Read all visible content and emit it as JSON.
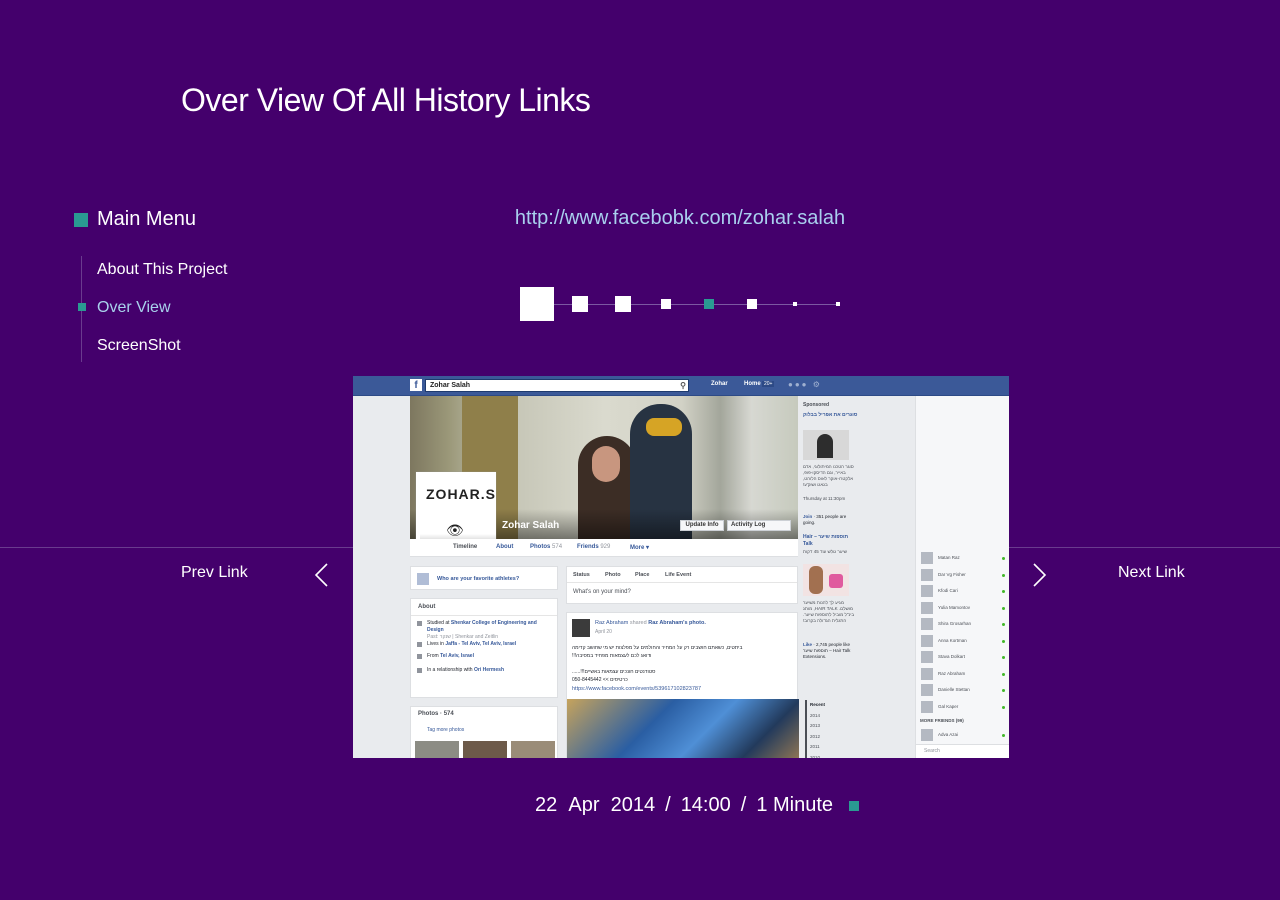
{
  "header": {
    "title_light": "Over View Of All ",
    "title_bold": "History Links"
  },
  "menu": {
    "heading": "Main Menu",
    "items": [
      {
        "label": "About This Project",
        "active": false
      },
      {
        "label": "Over View",
        "active": true
      },
      {
        "label": "ScreenShot",
        "active": false
      }
    ]
  },
  "link": {
    "url": "http://www.facebobk.com/zohar.salah"
  },
  "pager": {
    "current_index": 0,
    "accent_index": 4,
    "count": 8
  },
  "nav": {
    "prev_label": "Prev Link",
    "next_label": "Next Link"
  },
  "footer": {
    "day": "22",
    "month": "Apr",
    "year": "2014",
    "time": "14:00",
    "duration": "1 Minute"
  },
  "colors": {
    "background": "#44006c",
    "accent": "#2a9a92",
    "link": "#a9cfee",
    "facebook_blue": "#3b5998"
  },
  "screenshot": {
    "search_value": "Zohar Salah",
    "user": "Zohar",
    "home": "Home",
    "home_badge": "20+",
    "profile_name": "Zohar Salah",
    "avatar_text": "ZOHAR.S",
    "update_info": "Update Info",
    "activity_log": "Activity Log",
    "tabs": [
      {
        "label": "Timeline",
        "count": ""
      },
      {
        "label": "About",
        "count": ""
      },
      {
        "label": "Photos",
        "count": "574"
      },
      {
        "label": "Friends",
        "count": "929"
      },
      {
        "label": "More ▾",
        "count": ""
      }
    ],
    "athletes_prompt": "Who are your favorite athletes?",
    "about": {
      "heading": "About",
      "rows": [
        {
          "prefix": "Studied at ",
          "bold": "Shenkar College of Engineering and Design",
          "sub": "Past: שנקר | Shenkar and Zeitlin"
        },
        {
          "prefix": "Lives in ",
          "bold": "Jaffa - Tel Aviv, Tel Aviv, Israel",
          "sub": ""
        },
        {
          "prefix": "From ",
          "bold": "Tel Aviv, Israel",
          "sub": ""
        },
        {
          "prefix": "In a relationship with ",
          "bold": "Ori Hermesh",
          "sub": ""
        }
      ]
    },
    "photos": {
      "heading": "Photos",
      "count": "574",
      "tag": "Tag more photos"
    },
    "composer": {
      "actions": [
        "Status",
        "Photo",
        "Place",
        "Life Event"
      ],
      "placeholder": "What's on your mind?"
    },
    "post": {
      "author": "Raz Abraham",
      "shared": "shared",
      "shared_from": "Raz Abraham's photo.",
      "date": "April 20",
      "lines": [
        "ביתטים, כשאתם חושבים רק על המחיר והחולמים על מפלצות יש מי שחושב קדימה",
        "ודואג לכם לעצמאות מפחיד במסיבה!!!",
        "סטודנטים חונכים עצמאות באשיים!!!......",
        "כרטיסים >> 050-8445442"
      ],
      "link": "https://www.facebook.com/events/539617102823787"
    },
    "ads": {
      "sponsored": "Sponsored",
      "ad1_title": "סוגרים את אפריל בבלוק",
      "ad1_body": "סוגר הטכנו המיתולוגי, אדם באייר, וגם הדיסקו-פופ, אלקטרו-אוקר לאוס הלוהט, בגאגו ושוק'ע!",
      "ad1_time": "Thursday at 11:30pm",
      "ad1_join": "Join",
      "ad1_going": "· 351 people are going.",
      "ad2_title": "תוספות שיער – Hair Talk",
      "ad2_sub": "שיער גולש עוד 45 דקות",
      "ad2_body": "מגיע לך להנות משיער מושלם. HAIR TALK, מותג בינ\"ל מוביל לתוספות שיער. התגלית הגדולה בקרוב!",
      "ad2_like": "Like",
      "ad2_likes": "· 2,745 people like תוספות שיער – Hair Talk Extensions.",
      "years": [
        "Recent",
        "2014",
        "2013",
        "2012",
        "2011",
        "2010",
        "2009",
        "2008"
      ]
    },
    "chat": {
      "friends": [
        "Matan Raz",
        "Dar Vg Fisher",
        "Kfodi Cari",
        "Yulia Mamontov",
        "Shira Grosarhan",
        "Anna Kortman",
        "Stava Dolkart",
        "Raz Abraham",
        "Danielle Stettan",
        "Gal Kaper"
      ],
      "more_friends": "MORE FRIENDS (99)",
      "more_list": [
        "Adva Azai"
      ],
      "search": "Search"
    }
  }
}
